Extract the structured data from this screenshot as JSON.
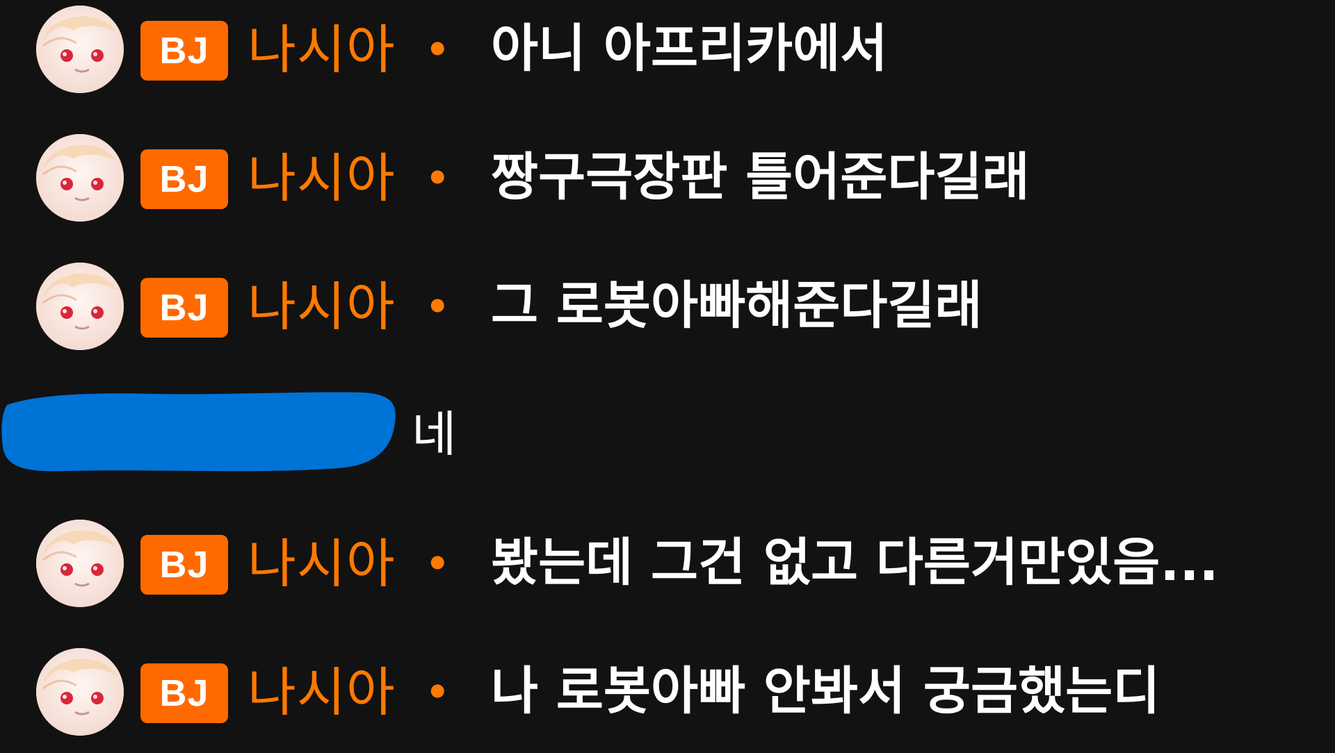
{
  "chat": {
    "bj_messages_1": {
      "badge": "BJ",
      "nickname": "나시아",
      "separator": "•",
      "text": "아니 아프리카에서"
    },
    "bj_messages_2": {
      "badge": "BJ",
      "nickname": "나시아",
      "separator": "•",
      "text": "짱구극장판 틀어준다길래"
    },
    "bj_messages_3": {
      "badge": "BJ",
      "nickname": "나시아",
      "separator": "•",
      "text": "그 로봇아빠해준다길래"
    },
    "viewer_message": {
      "text": "네",
      "redaction_color": "#0073d6"
    },
    "bj_messages_4": {
      "badge": "BJ",
      "nickname": "나시아",
      "separator": "•",
      "text": "봤는데 그건 없고 다른거만있음..."
    },
    "bj_messages_5": {
      "badge": "BJ",
      "nickname": "나시아",
      "separator": "•",
      "text": "나 로봇아빠 안봐서 궁금했는디"
    }
  },
  "colors": {
    "background": "#121212",
    "badge": "#ff6a00",
    "nickname": "#ff7a00",
    "message": "#ffffff"
  },
  "icons": {
    "avatar": "anime-avatar-icon"
  }
}
